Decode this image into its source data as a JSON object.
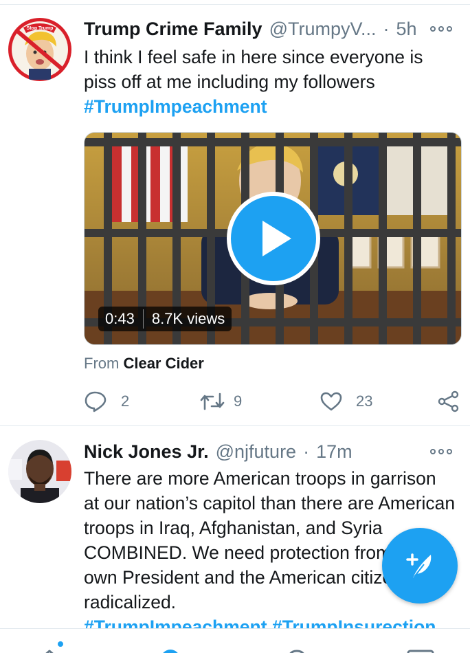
{
  "colors": {
    "accent": "#1da1f2",
    "text": "#14171a",
    "muted": "#657786"
  },
  "tweets": [
    {
      "name": "Trump Crime Family",
      "handle": "@TrumpyV...",
      "separator": "·",
      "time": "5h",
      "text": "I think I feel safe in here since everyone is piss off at me including my followers",
      "hashtag": "#TrumpImpeachment",
      "avatar_text": "Stop Trump",
      "media": {
        "duration": "0:43",
        "views": "8.7K views",
        "play_icon": "play-icon"
      },
      "source_prefix": "From",
      "source_name": "Clear Cider",
      "actions": {
        "replies": "2",
        "retweets": "9",
        "likes": "23"
      }
    },
    {
      "name": "Nick Jones Jr.",
      "handle": "@njfuture",
      "separator": "·",
      "time": "17m",
      "text": "There are more American troops in garrison at our nation’s capitol than there are American troops in Iraq, Afghanistan, and Syria COMBINED. We need protection from our own President and the American citizens he’s radicalized.",
      "hashtags": "#TrumpImpeachment #TrumpInsurection"
    }
  ],
  "fab": {
    "icon": "compose-tweet-icon"
  },
  "nav": {
    "icons": [
      "home-icon",
      "search-icon",
      "notifications-icon",
      "messages-icon"
    ]
  }
}
